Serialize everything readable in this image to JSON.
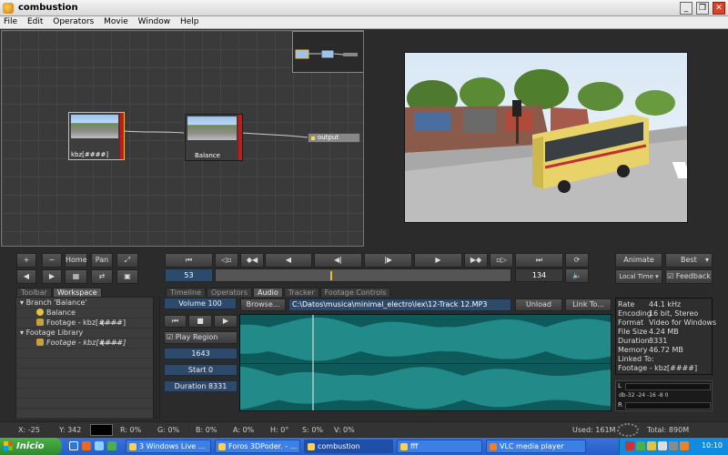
{
  "window": {
    "title": "combustion"
  },
  "menu": [
    "File",
    "Edit",
    "Operators",
    "Movie",
    "Window",
    "Help"
  ],
  "graph": {
    "nodes": [
      {
        "label": "kbz[####]"
      },
      {
        "label": "Balance"
      }
    ],
    "output_label": "output"
  },
  "toolbar": {
    "home": "Home",
    "pan": "Pan",
    "plus": "+",
    "minus": "−"
  },
  "transport": {
    "current_frame": "53",
    "end_frame": "134",
    "progress": 0.39
  },
  "right_controls": {
    "animate": "Animate",
    "quality": "Best",
    "time_mode": "Local Time",
    "feedback": "Feedback"
  },
  "left_tabs": [
    "Toolbar",
    "Workspace"
  ],
  "audio_tabs": [
    "Timeline",
    "Operators",
    "Audio",
    "Tracker",
    "Footage Controls"
  ],
  "workspace": [
    {
      "label": "Branch 'Balance'",
      "indent": 0
    },
    {
      "label": "Balance",
      "indent": 2
    },
    {
      "label": "Footage - kbz[####]",
      "indent": 2
    },
    {
      "label": "Footage Library",
      "indent": 0
    },
    {
      "label": "Footage - kbz[####]",
      "indent": 2
    }
  ],
  "audio": {
    "volume": "Volume 100",
    "play_region": "Play Region",
    "region_value": "1643",
    "start": "Start 0",
    "duration": "Duration 8331",
    "browse": "Browse...",
    "path": "C:\\Datos\\musica\\minimal_electro\\lex\\12-Track 12.MP3",
    "unload": "Unload",
    "link_to": "Link To..."
  },
  "info": [
    {
      "k": "Rate",
      "v": "44.1 kHz"
    },
    {
      "k": "Encoding",
      "v": "16 bit, Stereo"
    },
    {
      "k": "Format",
      "v": "Video for Windows"
    },
    {
      "k": "File Size",
      "v": "4.24 MB"
    },
    {
      "k": "Duration",
      "v": "8331"
    },
    {
      "k": "Memory",
      "v": "46.72 MB"
    },
    {
      "k": "Linked To:",
      "v": ""
    },
    {
      "k": "Footage - kbz[####]",
      "v": ""
    }
  ],
  "meter": {
    "L": "L",
    "R": "R",
    "scale": "db-32  -24  -16  -8    0"
  },
  "status": {
    "x": "X:  -25",
    "y": "Y:  342",
    "r": "R:  0%",
    "g": "G:  0%",
    "b": "B:  0%",
    "a": "A:  0%",
    "h": "H:  0°",
    "s": "S:  0%",
    "v": "V:  0%",
    "used": "Used: 161M",
    "total": "Total: 890M"
  },
  "taskbar": {
    "start": "Inicio",
    "tasks": [
      "3 Windows Live ...",
      "Foros 3DPoder. - ...",
      "combustion",
      "fff",
      "VLC media player"
    ],
    "clock": "10:10"
  }
}
